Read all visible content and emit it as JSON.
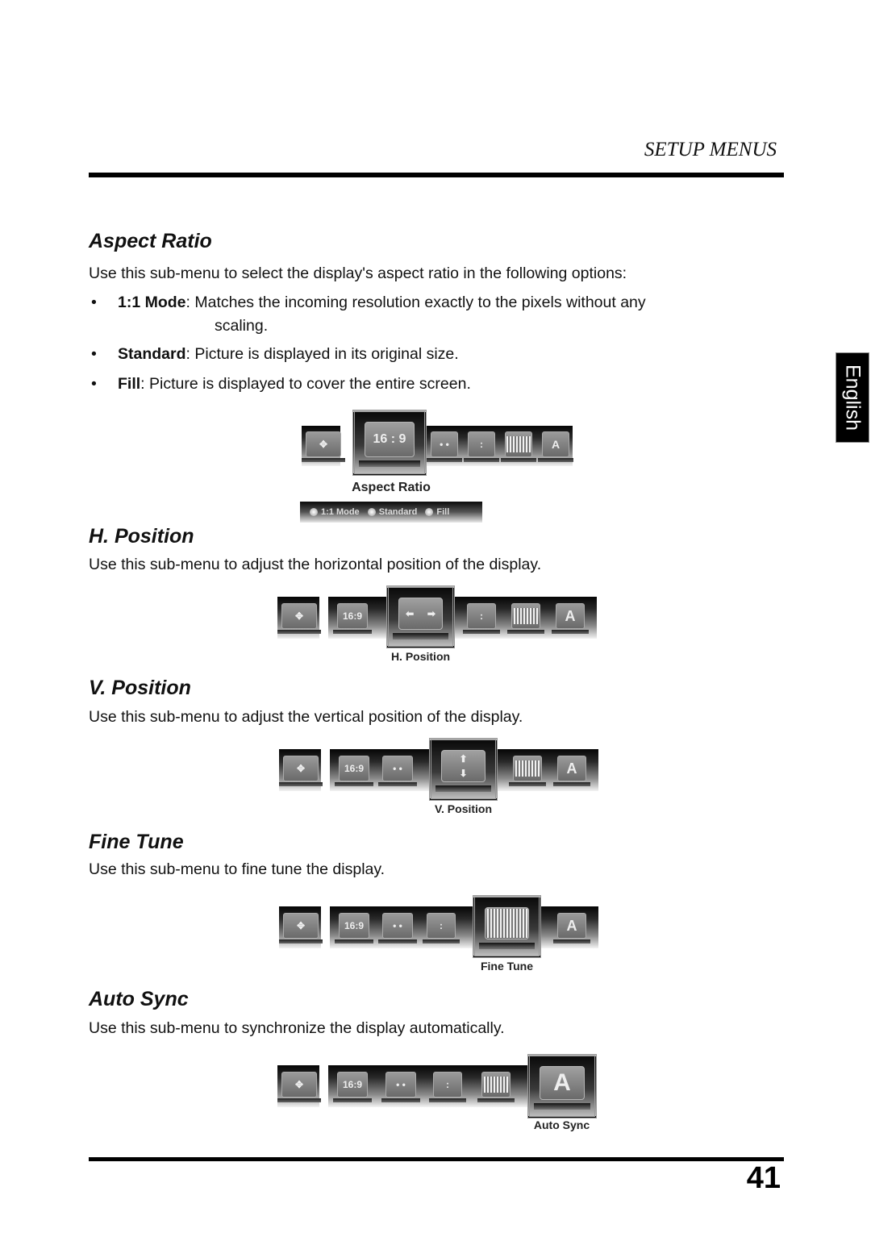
{
  "header": {
    "section_title": "Setup Menus",
    "section_title_display": "SETUP MENUS"
  },
  "language_tab": "English",
  "page_number": "41",
  "sections": {
    "aspect_ratio": {
      "heading": "Aspect Ratio",
      "intro": "Use this sub-menu to select the display's aspect ratio in the following options:",
      "bullets": [
        {
          "term": "1:1 Mode",
          "text": ": Matches the incoming resolution exactly to the pixels without any",
          "continuation": "scaling."
        },
        {
          "term": "Standard",
          "text": ": Picture is displayed in its original size."
        },
        {
          "term": "Fill",
          "text": ": Picture is displayed to cover the entire screen."
        }
      ],
      "osd": {
        "selected_label": "Aspect Ratio",
        "selected_icon_text": "16 : 9",
        "options": [
          "1:1 Mode",
          "Standard",
          "Fill"
        ],
        "auto_icon_text": "A"
      }
    },
    "h_position": {
      "heading": "H. Position",
      "intro": "Use this sub-menu to adjust the horizontal position of the display.",
      "osd": {
        "selected_label": "H. Position",
        "ratio_text": "16:9",
        "auto_icon_text": "A"
      }
    },
    "v_position": {
      "heading": "V. Position",
      "intro": "Use this sub-menu to adjust the vertical position of the display.",
      "osd": {
        "selected_label": "V. Position",
        "ratio_text": "16:9",
        "auto_icon_text": "A"
      }
    },
    "fine_tune": {
      "heading": "Fine Tune",
      "intro": "Use this sub-menu to fine tune the display.",
      "osd": {
        "selected_label": "Fine Tune",
        "ratio_text": "16:9",
        "auto_icon_text": "A"
      }
    },
    "auto_sync": {
      "heading": "Auto Sync",
      "intro": "Use this sub-menu to synchronize the display automatically.",
      "osd": {
        "selected_label": "Auto Sync",
        "ratio_text": "16:9",
        "auto_icon_text": "A"
      }
    }
  }
}
